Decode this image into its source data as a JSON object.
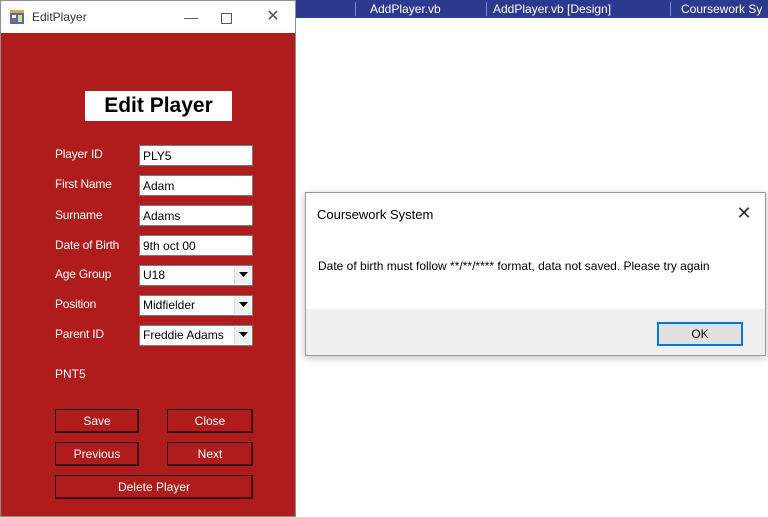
{
  "ide": {
    "tabs": [
      {
        "label": "AddPlayer.vb"
      },
      {
        "label": "AddPlayer.vb [Design]"
      },
      {
        "label": "Coursework Sy"
      }
    ]
  },
  "edit_player_window": {
    "title": "EditPlayer",
    "heading": "Edit Player",
    "fields": {
      "player_id": {
        "label": "Player ID",
        "value": "PLY5"
      },
      "first_name": {
        "label": "First Name",
        "value": "Adam"
      },
      "surname": {
        "label": "Surname",
        "value": "Adams"
      },
      "date_of_birth": {
        "label": "Date of Birth",
        "value": "9th oct 00"
      },
      "age_group": {
        "label": "Age Group",
        "value": "U18"
      },
      "position": {
        "label": "Position",
        "value": "Midfielder"
      },
      "parent_id": {
        "label": "Parent ID",
        "value": "Freddie Adams"
      }
    },
    "parent_id_display": "PNT5",
    "buttons": {
      "save": "Save",
      "close": "Close",
      "previous": "Previous",
      "next": "Next",
      "delete": "Delete Player"
    },
    "colors": {
      "background": "#b01c1c"
    }
  },
  "message_box": {
    "title": "Coursework System",
    "message": "Date of birth must follow **/**/**** format, data not saved. Please try again",
    "ok_label": "OK"
  }
}
